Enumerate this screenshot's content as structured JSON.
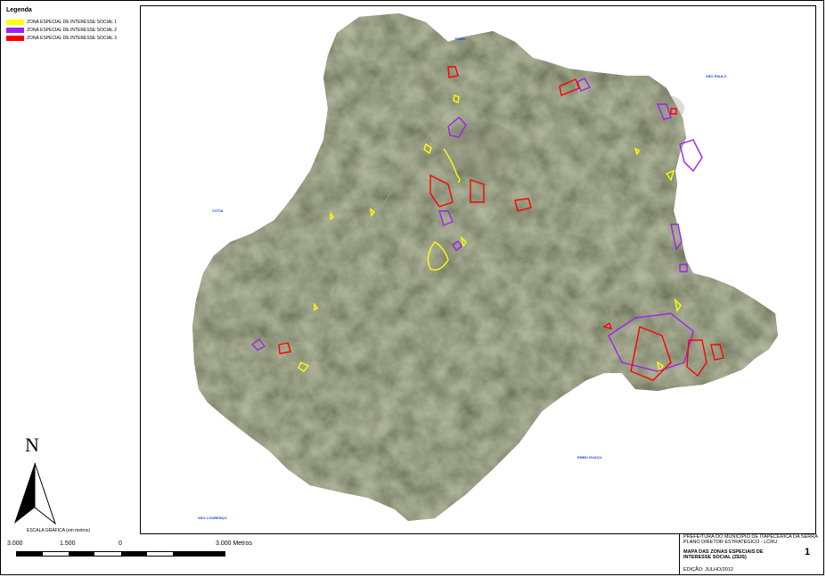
{
  "legend": {
    "title": "Legenda",
    "items": [
      {
        "label": "ZONA ESPECIAL DE INTERESSE SOCIAL 1",
        "color": "#ffff00"
      },
      {
        "label": "ZONA ESPECIAL DE INTERESSE SOCIAL 2",
        "color": "#a020f0"
      },
      {
        "label": "ZONA ESPECIAL DE INTERESSE SOCIAL 3",
        "color": "#ff0000"
      }
    ]
  },
  "places": {
    "embu_north": "EMBU",
    "sao_paulo": "SÃO PAULO",
    "cotia": "COTIA",
    "embu_guacu": "EMBU GUAÇU",
    "sao_lourenco": "SÃO LOURENÇO"
  },
  "north_label": "N",
  "scale": {
    "title": "ESCALA GRÁFICA (em metros)",
    "ticks": [
      "3.000",
      "1.500",
      "0",
      "3.000 Metros"
    ]
  },
  "title_block": {
    "line1": "PREFEITURA DO MUNICÍPIO DE ITAPECERICA DA SERRA",
    "line2": "PLANO DIRETOR ESTRATÉGICO - LCRU",
    "map_title_1": "MAPA DAS ZONAS ESPECIAIS DE",
    "map_title_2": "INTERESSE SOCIAL (ZEIS)",
    "edition": "EDIÇÃO: JULHO/2012",
    "sheet": "1"
  },
  "colors": {
    "zeis1": "#ffff00",
    "zeis2": "#a020f0",
    "zeis3": "#ff0000",
    "terrain": "#4f5540"
  }
}
